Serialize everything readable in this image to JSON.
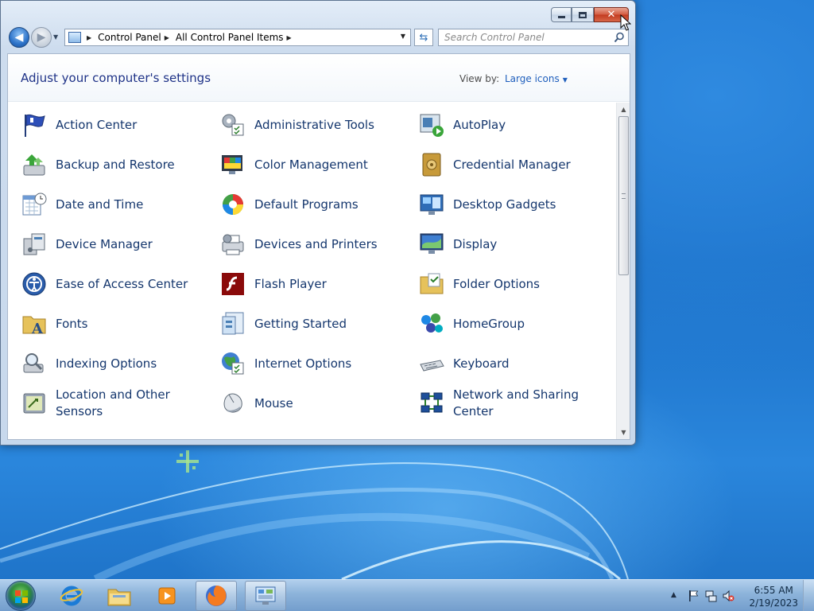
{
  "window": {
    "nav": {
      "back_icon": "back-arrow-icon",
      "forward_icon": "forward-arrow-icon"
    },
    "address": {
      "crumbs": [
        "Control Panel",
        "All Control Panel Items"
      ]
    },
    "search": {
      "placeholder": "Search Control Panel"
    },
    "header": {
      "title": "Adjust your computer's settings",
      "view_by_label": "View by:",
      "view_by_value": "Large icons"
    },
    "items": [
      {
        "label": "Action Center",
        "icon": "flag-icon"
      },
      {
        "label": "Administrative Tools",
        "icon": "tools-icon"
      },
      {
        "label": "AutoPlay",
        "icon": "autoplay-icon"
      },
      {
        "label": "Backup and Restore",
        "icon": "backup-icon"
      },
      {
        "label": "Color Management",
        "icon": "color-icon"
      },
      {
        "label": "Credential Manager",
        "icon": "vault-icon"
      },
      {
        "label": "Date and Time",
        "icon": "calendar-icon"
      },
      {
        "label": "Default Programs",
        "icon": "default-programs-icon"
      },
      {
        "label": "Desktop Gadgets",
        "icon": "gadgets-icon"
      },
      {
        "label": "Device Manager",
        "icon": "device-manager-icon"
      },
      {
        "label": "Devices and Printers",
        "icon": "printer-icon"
      },
      {
        "label": "Display",
        "icon": "monitor-icon"
      },
      {
        "label": "Ease of Access Center",
        "icon": "accessibility-icon"
      },
      {
        "label": "Flash Player",
        "icon": "flash-icon"
      },
      {
        "label": "Folder Options",
        "icon": "folder-icon"
      },
      {
        "label": "Fonts",
        "icon": "fonts-icon"
      },
      {
        "label": "Getting Started",
        "icon": "getting-started-icon"
      },
      {
        "label": "HomeGroup",
        "icon": "homegroup-icon"
      },
      {
        "label": "Indexing Options",
        "icon": "indexing-icon"
      },
      {
        "label": "Internet Options",
        "icon": "globe-icon"
      },
      {
        "label": "Keyboard",
        "icon": "keyboard-icon"
      },
      {
        "label": "Location and Other Sensors",
        "icon": "sensor-icon"
      },
      {
        "label": "Mouse",
        "icon": "mouse-icon"
      },
      {
        "label": "Network and Sharing Center",
        "icon": "network-icon"
      }
    ]
  },
  "taskbar": {
    "pinned": [
      "windows-explorer",
      "internet-explorer",
      "file-explorer",
      "media-player",
      "firefox",
      "control-panel"
    ],
    "clock": {
      "time": "6:55 AM",
      "date": "2/19/2023"
    }
  },
  "colors": {
    "link_text": "#14366d",
    "title_text": "#1e3287",
    "close_button": "#c23a1f",
    "desktop": "#1a6fc4"
  }
}
